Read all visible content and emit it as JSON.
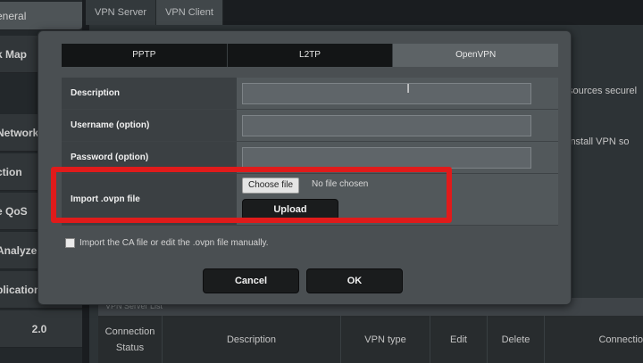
{
  "top_tabs": [
    "VPN Server",
    "VPN Client"
  ],
  "sidebar": {
    "items": [
      "eneral",
      "k Map",
      "Network",
      "ction",
      "e QoS",
      "Analyze",
      "plication",
      "2.0"
    ]
  },
  "background": {
    "right_text_1": "sources securel",
    "right_text_2": "install VPN so",
    "table_caption": "VPN Server List",
    "columns": [
      "Connection Status",
      "Description",
      "VPN type",
      "Edit",
      "Delete",
      "Connectio"
    ]
  },
  "modal": {
    "tabs": [
      {
        "label": "PPTP",
        "active": false
      },
      {
        "label": "L2TP",
        "active": false
      },
      {
        "label": "OpenVPN",
        "active": true
      }
    ],
    "fields": {
      "description": {
        "label": "Description",
        "value": ""
      },
      "username": {
        "label": "Username (option)",
        "value": ""
      },
      "password": {
        "label": "Password (option)",
        "value": ""
      }
    },
    "import": {
      "label": "Import .ovpn file",
      "choose_label": "Choose file",
      "status": "No file chosen",
      "upload_label": "Upload"
    },
    "manual_checkbox": {
      "label": "Import the CA file or edit the .ovpn file manually.",
      "checked": false
    },
    "cancel_label": "Cancel",
    "ok_label": "OK"
  },
  "colors": {
    "highlight": "#e01b1b",
    "active_tab": "#5d6366",
    "inactive_tab": "#131516"
  }
}
